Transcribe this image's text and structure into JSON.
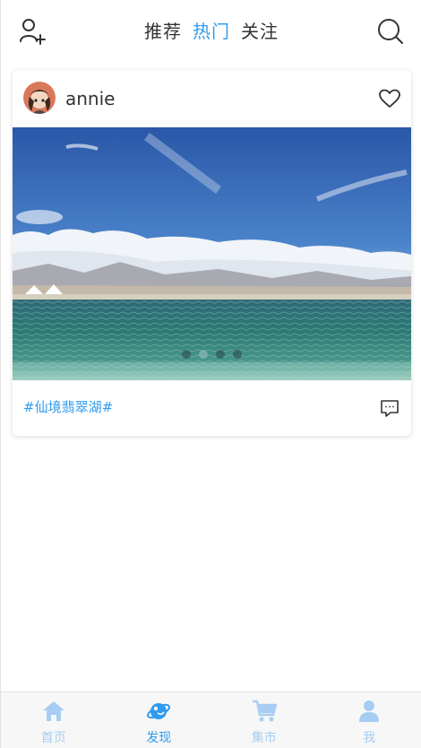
{
  "header": {
    "tabs": [
      {
        "label": "推荐",
        "active": false
      },
      {
        "label": "热门",
        "active": true
      },
      {
        "label": "关注",
        "active": false
      }
    ],
    "left_icon": "add-user-icon",
    "right_icon": "search-icon"
  },
  "post": {
    "username": "annie",
    "tag": "#仙境翡翠湖#",
    "carousel": {
      "count": 4,
      "active_index": 1
    },
    "icons": {
      "like": "heart-outline-icon",
      "comment": "comment-icon"
    }
  },
  "nav": {
    "items": [
      {
        "label": "首页",
        "icon": "home-icon",
        "active": false
      },
      {
        "label": "发现",
        "icon": "discover-planet-icon",
        "active": true
      },
      {
        "label": "集市",
        "icon": "cart-icon",
        "active": false
      },
      {
        "label": "我",
        "icon": "user-icon",
        "active": false
      }
    ]
  },
  "colors": {
    "accent": "#2f9bee",
    "nav_inactive": "#a7cdf3",
    "text": "#333333"
  }
}
